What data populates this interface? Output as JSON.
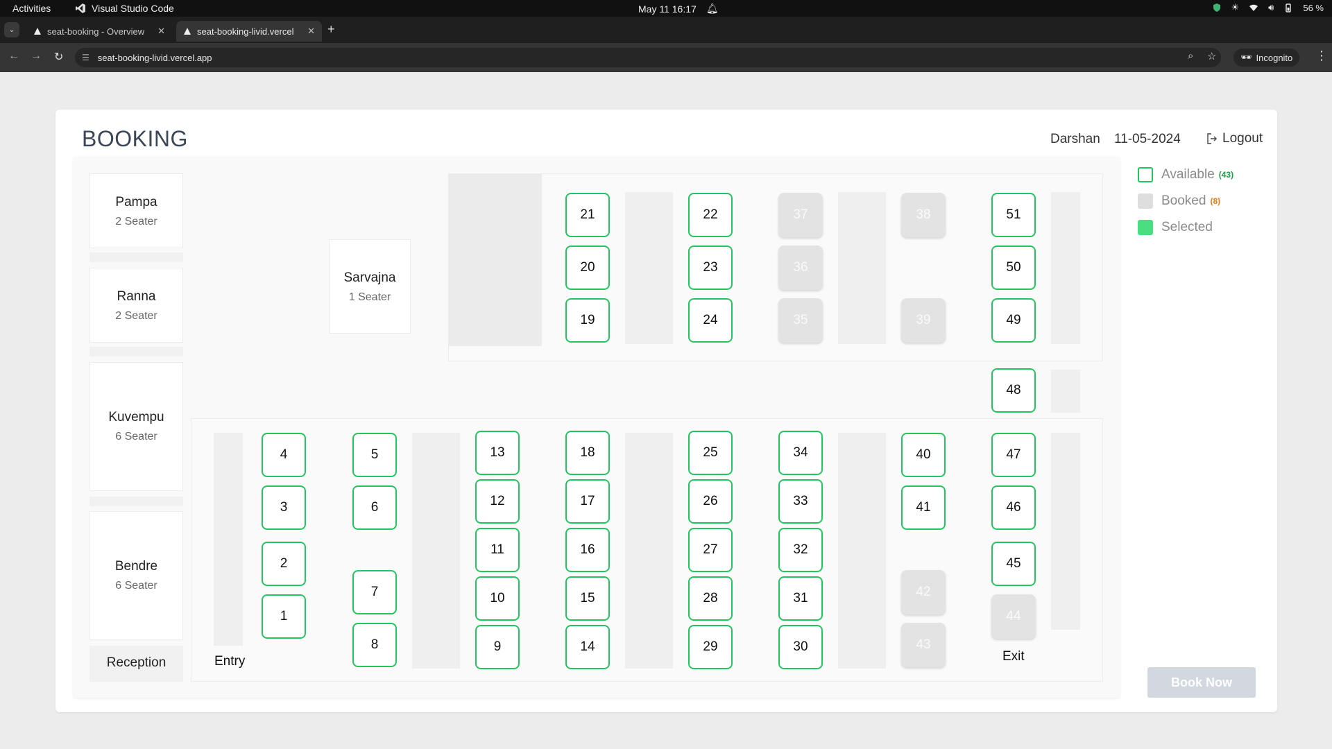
{
  "os": {
    "activities": "Activities",
    "app_name": "Visual Studio Code",
    "datetime": "May 11  16:17",
    "battery": "56 %"
  },
  "browser": {
    "tabs": [
      {
        "title": "seat-booking - Overview"
      },
      {
        "title": "seat-booking-livid.vercel"
      }
    ],
    "url": "seat-booking-livid.vercel.app",
    "incognito": "Incognito"
  },
  "page": {
    "title": "BOOKING",
    "user": "Darshan",
    "date": "11-05-2024",
    "logout": "Logout"
  },
  "rooms": [
    {
      "name": "Pampa",
      "capacity": "2 Seater"
    },
    {
      "name": "Ranna",
      "capacity": "2 Seater"
    },
    {
      "name": "Kuvempu",
      "capacity": "6 Seater"
    },
    {
      "name": "Bendre",
      "capacity": "6 Seater"
    }
  ],
  "cabin": {
    "name": "Sarvajna",
    "capacity": "1 Seater"
  },
  "labels": {
    "reception": "Reception",
    "entry": "Entry",
    "exit": "Exit"
  },
  "seats": {
    "s1": "1",
    "s2": "2",
    "s3": "3",
    "s4": "4",
    "s5": "5",
    "s6": "6",
    "s7": "7",
    "s8": "8",
    "s9": "9",
    "s10": "10",
    "s11": "11",
    "s12": "12",
    "s13": "13",
    "s14": "14",
    "s15": "15",
    "s16": "16",
    "s17": "17",
    "s18": "18",
    "s19": "19",
    "s20": "20",
    "s21": "21",
    "s22": "22",
    "s23": "23",
    "s24": "24",
    "s25": "25",
    "s26": "26",
    "s27": "27",
    "s28": "28",
    "s29": "29",
    "s30": "30",
    "s31": "31",
    "s32": "32",
    "s33": "33",
    "s34": "34",
    "s35": "35",
    "s36": "36",
    "s37": "37",
    "s38": "38",
    "s39": "39",
    "s40": "40",
    "s41": "41",
    "s42": "42",
    "s43": "43",
    "s44": "44",
    "s45": "45",
    "s46": "46",
    "s47": "47",
    "s48": "48",
    "s49": "49",
    "s50": "50",
    "s51": "51"
  },
  "booked_seats": [
    "35",
    "36",
    "37",
    "38",
    "39",
    "42",
    "43",
    "44"
  ],
  "legend": {
    "available": "Available",
    "available_count": "(43)",
    "booked": "Booked",
    "booked_count": "(8)",
    "selected": "Selected"
  },
  "book_now": "Book Now",
  "colors": {
    "available_border": "#22c55e",
    "selected": "#4ade80",
    "booked": "#e3e3e3",
    "available_count": "#16a34a",
    "booked_count": "#ea7a14"
  }
}
